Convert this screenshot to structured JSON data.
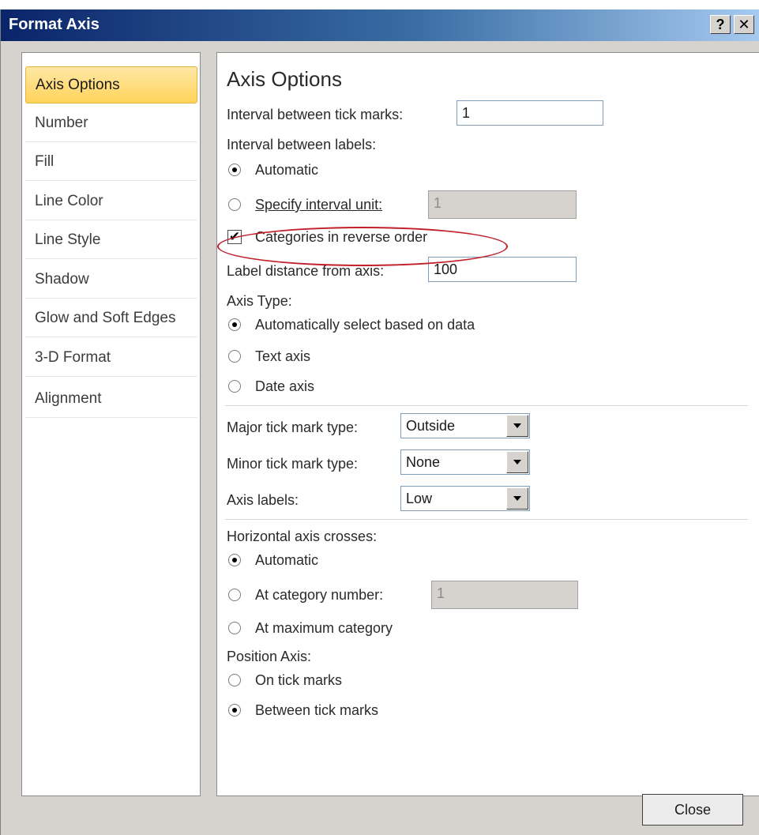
{
  "dialog": {
    "title": "Format Axis",
    "help_label": "?",
    "close_label": "✕",
    "close_button_label": "Close"
  },
  "nav": {
    "items": [
      {
        "label": "Axis Options",
        "selected": true
      },
      {
        "label": "Number"
      },
      {
        "label": "Fill"
      },
      {
        "label": "Line Color"
      },
      {
        "label": "Line Style"
      },
      {
        "label": "Shadow"
      },
      {
        "label": "Glow and Soft Edges"
      },
      {
        "label": "3-D Format"
      },
      {
        "label": "Alignment"
      }
    ]
  },
  "options": {
    "heading": "Axis Options",
    "interval_tick_label": "Interval between tick marks:",
    "interval_tick_value": "1",
    "interval_labels_heading": "Interval between labels:",
    "automatic_label": "Automatic",
    "specify_interval_label": "Specify interval unit:",
    "specify_interval_value": "1",
    "reverse_order_label": "Categories in reverse order",
    "reverse_order_checked": true,
    "label_distance_label": "Label distance from axis:",
    "label_distance_value": "100",
    "axis_type_heading": "Axis Type:",
    "auto_select_label": "Automatically select based on data",
    "text_axis_label": "Text axis",
    "date_axis_label": "Date axis",
    "major_tick_label": "Major tick mark type:",
    "major_tick_value": "Outside",
    "minor_tick_label": "Minor tick mark type:",
    "minor_tick_value": "None",
    "axis_labels_label": "Axis labels:",
    "axis_labels_value": "Low",
    "h_axis_crosses_heading": "Horizontal axis crosses:",
    "crosses_automatic_label": "Automatic",
    "at_category_label": "At category number:",
    "at_category_value": "1",
    "at_max_category_label": "At maximum category",
    "position_axis_heading": "Position Axis:",
    "on_tick_label": "On tick marks",
    "between_tick_label": "Between tick marks"
  },
  "colors": {
    "title_bar_start": "#0a246a",
    "selected_nav": "#ffd35a",
    "annotation": "#c0202a"
  }
}
